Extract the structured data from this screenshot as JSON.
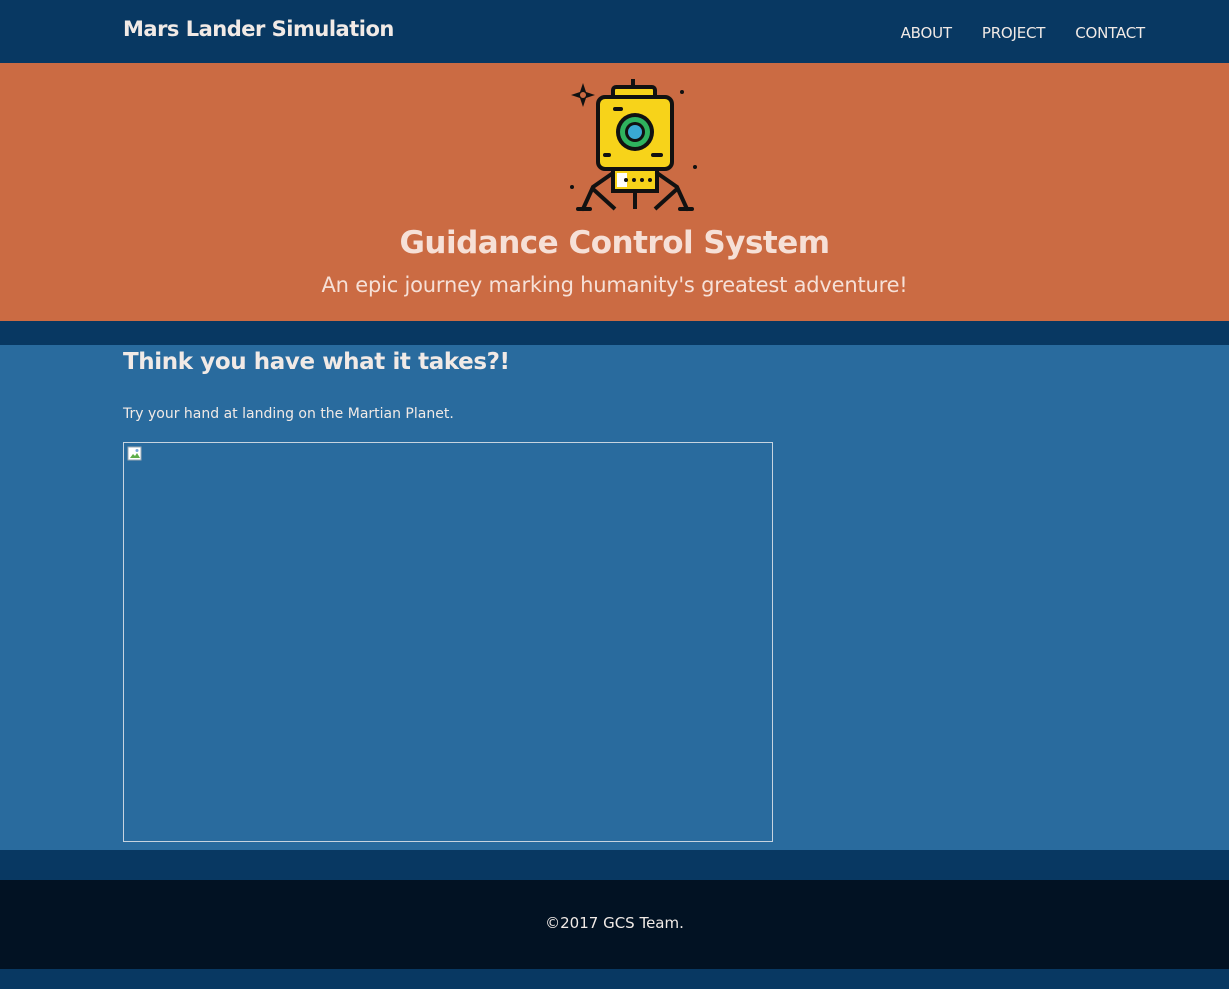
{
  "navbar": {
    "brand": "Mars Lander Simulation",
    "links": [
      "ABOUT",
      "PROJECT",
      "CONTACT"
    ]
  },
  "hero": {
    "icon": "lunar-lander-icon",
    "title": "Guidance Control System",
    "subtitle": "An epic journey marking humanity's greatest adventure!"
  },
  "main": {
    "heading": "Think you have what it takes?!",
    "description": "Try your hand at landing on the Martian Planet.",
    "game_embed_icon": "broken-image-icon"
  },
  "footer": {
    "copyright": "©2017 GCS Team."
  },
  "colors": {
    "nav_bg": "#083862",
    "hero_bg": "#cb6b43",
    "content_bg": "#296b9e",
    "footer_bg": "#021223",
    "text_light": "#f1eae6"
  }
}
